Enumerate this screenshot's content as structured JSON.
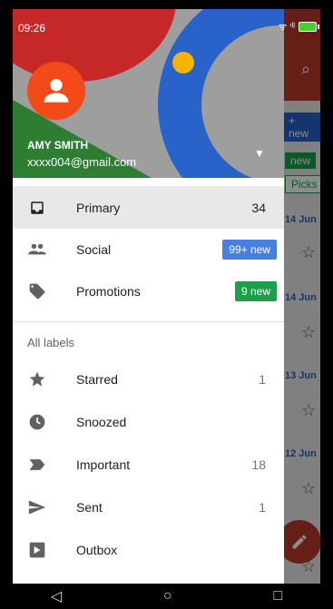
{
  "status": {
    "time": "09:26",
    "wifi_signal_text": "ᯤ ⁱˡˡ"
  },
  "background_app": {
    "tags": [
      "+ new",
      "new",
      "Picks"
    ],
    "dates": [
      "14 Jun",
      "14 Jun",
      "13 Jun",
      "12 Jun"
    ]
  },
  "account": {
    "name": "AMY SMITH",
    "email": "xxxx004@gmail.com"
  },
  "nav": {
    "primary": {
      "label": "Primary",
      "count": "34"
    },
    "social": {
      "label": "Social",
      "badge": "99+ new"
    },
    "promotions": {
      "label": "Promotions",
      "badge": "9 new"
    }
  },
  "labels_section": "All labels",
  "labels": {
    "starred": {
      "label": "Starred",
      "count": "1"
    },
    "snoozed": {
      "label": "Snoozed",
      "count": ""
    },
    "important": {
      "label": "Important",
      "count": "18"
    },
    "sent": {
      "label": "Sent",
      "count": "1"
    },
    "outbox": {
      "label": "Outbox",
      "count": ""
    }
  },
  "colors": {
    "social_badge": "#4a7fe0",
    "promotions_badge": "#1e9e4a",
    "avatar": "#f24a18"
  }
}
